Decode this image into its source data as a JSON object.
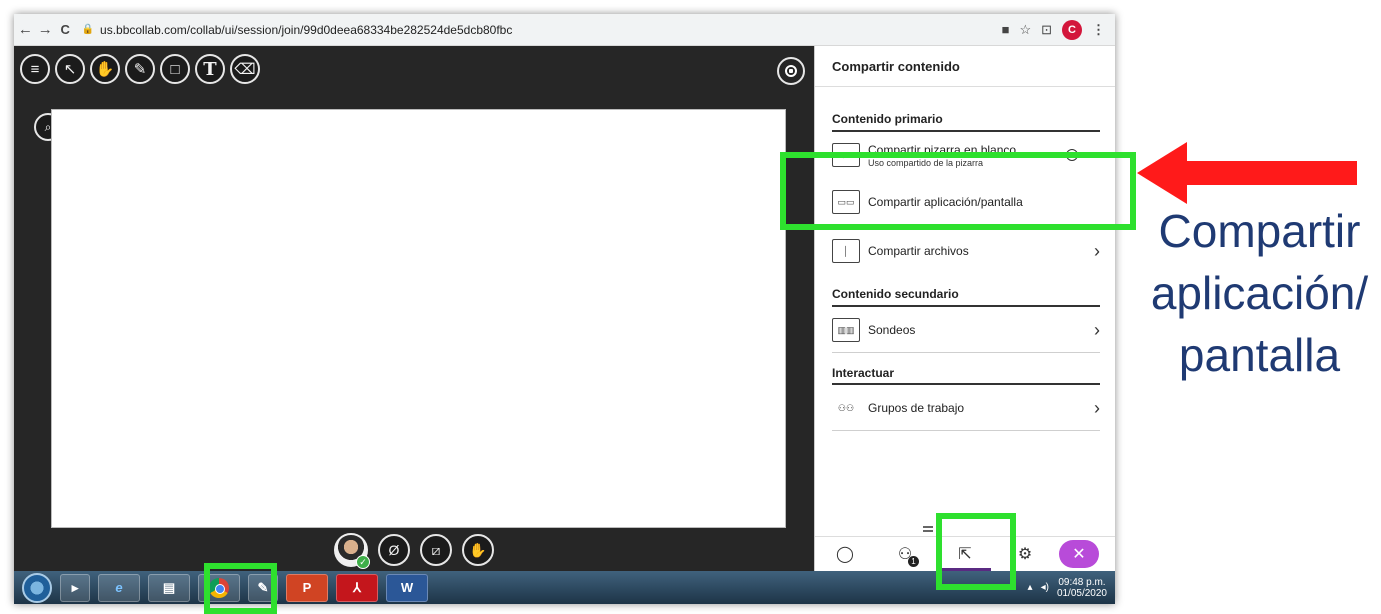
{
  "browser": {
    "back": "←",
    "forward": "→",
    "reload": "C",
    "url": "us.bbcollab.com/collab/ui/session/join/99d0deea68334be282524de5dcb80fbc",
    "profile_initial": "C",
    "icons": [
      "camera-icon",
      "star-icon",
      "cast-icon",
      "menu-dots-icon"
    ]
  },
  "toolbar": {
    "tools": [
      {
        "name": "menu-icon",
        "glyph": "≡"
      },
      {
        "name": "pointer-icon",
        "glyph": "↖"
      },
      {
        "name": "hand-icon",
        "glyph": "✋"
      },
      {
        "name": "pencil-icon",
        "glyph": "✎"
      },
      {
        "name": "rectangle-icon",
        "glyph": "□"
      },
      {
        "name": "text-tool-icon",
        "glyph": "T"
      },
      {
        "name": "eraser-icon",
        "glyph": "⌫"
      }
    ],
    "zoom_glyph": "⌕"
  },
  "panel": {
    "title": "Compartir contenido",
    "primary_section": "Contenido primario",
    "items": {
      "whiteboard_label": "Compartir pizarra en blanco",
      "whiteboard_sub": "Uso compartido de la pizarra",
      "app_label": "Compartir aplicación/pantalla",
      "files_label": "Compartir archivos"
    },
    "secondary_section": "Contenido secundario",
    "polls_label": "Sondeos",
    "interact_section": "Interactuar",
    "groups_label": "Grupos de trabajo",
    "bottom": {
      "attendee_badge": "1"
    }
  },
  "taskbar": {
    "time": "09:48 p.m.",
    "date": "01/05/2020",
    "apps": [
      "P",
      "W"
    ]
  },
  "annotation": {
    "line1": "Compartir",
    "line2": "aplicación/",
    "line3": "pantalla"
  },
  "colors": {
    "highlight": "#2ee02e",
    "arrow": "#ff1a1a",
    "annotation_text": "#1f3a73",
    "accent_purple": "#b84bd9"
  }
}
